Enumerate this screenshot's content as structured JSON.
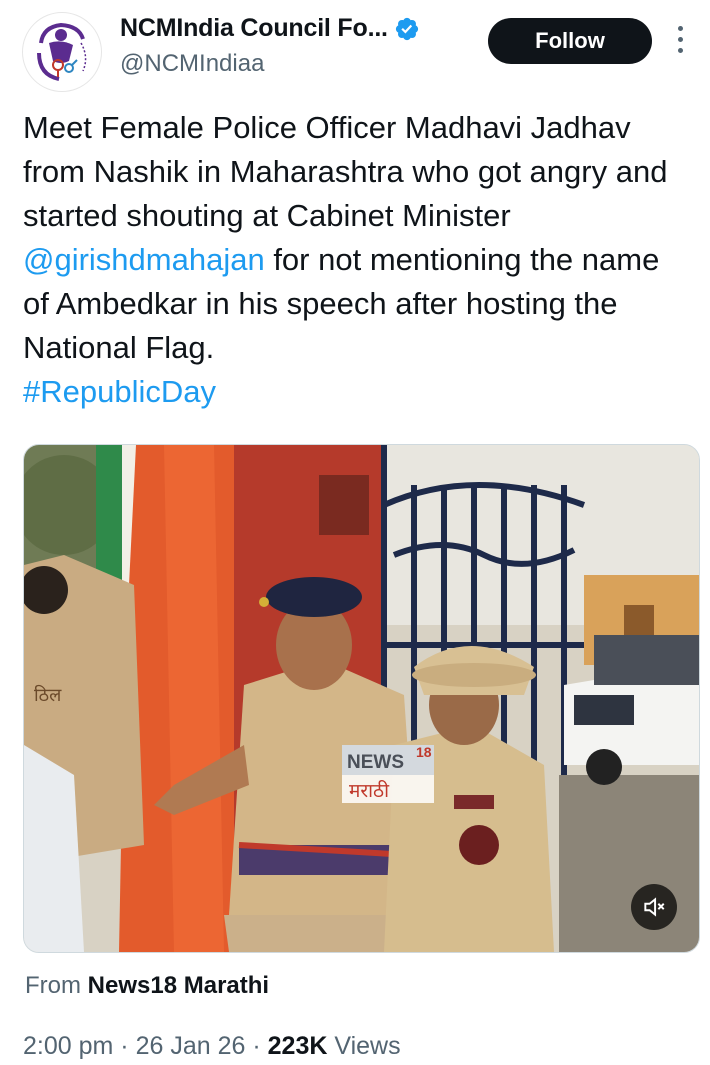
{
  "author": {
    "display_name": "NCMIndia Council Fo...",
    "handle": "@NCMIndiaa",
    "avatar_icon": "ncm-logo-icon",
    "verified_icon": "verified-badge-icon"
  },
  "actions": {
    "follow_label": "Follow",
    "more_icon": "more-options-icon"
  },
  "tweet": {
    "text_part1": "Meet Female Police Officer Madhavi Jadhav from Nashik in Maharashtra who got angry and started shouting at Cabinet Minister ",
    "mention": "@girishdmahajan",
    "text_part2": " for not mentioning the name of Ambedkar in his speech after hosting the National Flag.",
    "hashtag": "#RepublicDay"
  },
  "media": {
    "overlay_logo_top": "NEWS",
    "overlay_logo_num": "18",
    "overlay_logo_bottom": "मराठी",
    "mute_icon": "volume-muted-icon",
    "badge_text_left": "ठिल"
  },
  "source": {
    "prefix": "From",
    "name": "News18 Marathi"
  },
  "meta": {
    "time": "2:00 pm",
    "separator": "·",
    "date": "26 Jan 26",
    "views_count": "223K",
    "views_label": "Views"
  },
  "colors": {
    "link": "#1d9bf0",
    "text": "#0f1419",
    "secondary": "#536471",
    "follow_bg": "#0f1419",
    "verified": "#1d9bf0"
  }
}
